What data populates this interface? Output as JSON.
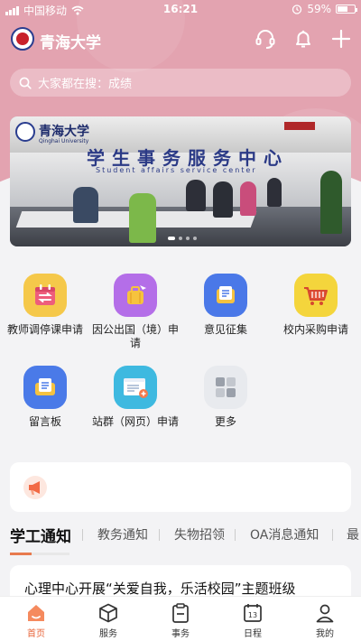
{
  "status_bar": {
    "carrier": "中国移动",
    "time": "16:21",
    "battery_percent": "59%",
    "battery_level": 0.59
  },
  "app": {
    "title": "青海大学",
    "icons": [
      "headset-icon",
      "bell-icon",
      "plus-icon"
    ]
  },
  "search": {
    "placeholder": "大家都在搜：成绩"
  },
  "banner": {
    "uni_name": "青海大学",
    "uni_name_en": "Qinghai University",
    "sign_text": "学生事务服务中心",
    "sign_sub": "Student affairs service center",
    "slide_count": 4,
    "active_slide": 0
  },
  "services": [
    {
      "label": "教师调停课申请",
      "icon": "calendar-swap-icon",
      "color": "#f5c84a"
    },
    {
      "label": "因公出国（境）申请",
      "icon": "suitcase-plane-icon",
      "color": "#b46ee8"
    },
    {
      "label": "意见征集",
      "icon": "feedback-doc-icon",
      "color": "#4a78e8"
    },
    {
      "label": "校内采购申请",
      "icon": "cart-icon",
      "color": "#f4d53c"
    },
    {
      "label": "留言板",
      "icon": "message-board-icon",
      "color": "#4a7ae8"
    },
    {
      "label": "站群（网页）申请",
      "icon": "webpage-add-icon",
      "color": "#3eb9e0"
    },
    {
      "label": "更多",
      "icon": "more-grid-icon",
      "color": "#e8eaee"
    }
  ],
  "tabs": [
    {
      "label": "学工通知",
      "active": true
    },
    {
      "label": "教务通知",
      "active": false
    },
    {
      "label": "失物招领",
      "active": false
    },
    {
      "label": "OA消息通知",
      "active": false
    },
    {
      "label": "最",
      "active": false
    }
  ],
  "news": {
    "title": "心理中心开展“关爱自我，乐活校园”主题班级"
  },
  "bottom_nav": [
    {
      "label": "首页",
      "icon": "home-icon",
      "active": true
    },
    {
      "label": "服务",
      "icon": "cube-icon",
      "active": false
    },
    {
      "label": "事务",
      "icon": "clipboard-icon",
      "active": false
    },
    {
      "label": "日程",
      "icon": "calendar-icon",
      "active": false
    },
    {
      "label": "我的",
      "icon": "user-icon",
      "active": false
    }
  ],
  "calendar_icon_day": "13",
  "colors": {
    "header_pink": "#e3a3b0",
    "accent_orange": "#e8653a"
  }
}
